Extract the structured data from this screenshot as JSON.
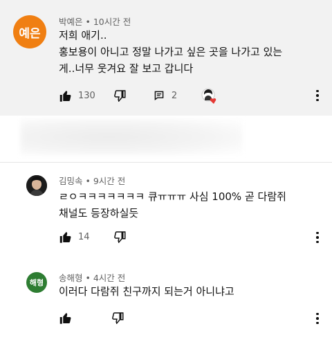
{
  "comments": [
    {
      "avatar_text": "예은",
      "author": "박예은",
      "time": "10시간 전",
      "lines": [
        "저희 애기..",
        "홍보용이 아니고 정말 나가고 싶은 곳을 나가고 있는",
        "게..너무 웃겨요 잘 보고 갑니다"
      ],
      "likes": "130",
      "replies": "2"
    },
    {
      "avatar_text": "",
      "author": "김밍속",
      "time": "9시간 전",
      "lines": [
        "ㄹㅇㅋㅋㅋㅋㅋㅋㅋ 큐ㅠㅠㅠ 사심 100% 곧 다람쥐",
        "채널도 등장하실듯"
      ],
      "likes": "14"
    },
    {
      "avatar_text": "해형",
      "author": "송해형",
      "time": "4시간 전",
      "lines": [
        "이러다 다람쥐 친구까지 되는거 아니냐고"
      ]
    }
  ],
  "colors": {
    "avatar_1": "#f07f12",
    "avatar_3": "#2e7d32",
    "heart": "#e53935",
    "highlight_bg": "#f2f2f2"
  },
  "icons": [
    "thumb-up-icon",
    "thumb-down-icon",
    "reply-icon",
    "more-vert-icon",
    "heart-icon"
  ]
}
